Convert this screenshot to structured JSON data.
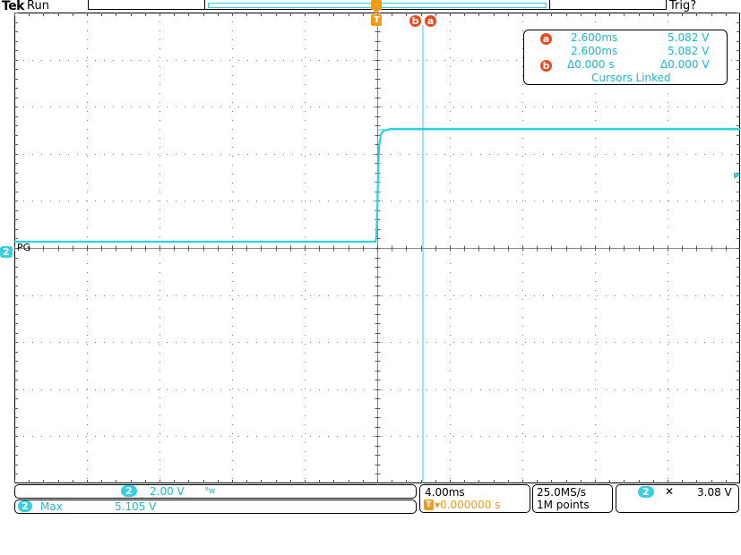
{
  "header": {
    "brand": "Tek",
    "run_state": "Run",
    "trigger_status": "Trig?"
  },
  "markers": {
    "trigger_marker": "T",
    "cursor_b": "b",
    "cursor_a": "a",
    "channel_marker": "2",
    "channel_label": "PG"
  },
  "cursor_readout": {
    "a_time": "2.600ms",
    "a_volt": "5.082 V",
    "b_time": "2.600ms",
    "b_volt": "5.082 V",
    "delta_time": "Δ0.000 s",
    "delta_volt": "Δ0.000 V",
    "linked": "Cursors Linked"
  },
  "channel": {
    "number": "2",
    "scale": "2.00 V",
    "bandwidth_symbol": "ᴮw"
  },
  "measurement": {
    "channel": "2",
    "label": "Max",
    "value": "5.105 V"
  },
  "timebase": {
    "scale": "4.00ms",
    "trigger_icon": "T",
    "position": "▾0.000000 s"
  },
  "acquisition": {
    "sample_rate": "25.0MS/s",
    "record_length": "1M points"
  },
  "trigger": {
    "channel": "2",
    "slope_symbol": "✕",
    "level": "3.08 V"
  },
  "colors": {
    "trace": "#2ad3df",
    "cursor": "#2ad3df",
    "trigger": "#f29a1a",
    "cursor_badge": "#f0461e",
    "channel_badge": "#39cfe0",
    "grid": "#555555"
  }
}
